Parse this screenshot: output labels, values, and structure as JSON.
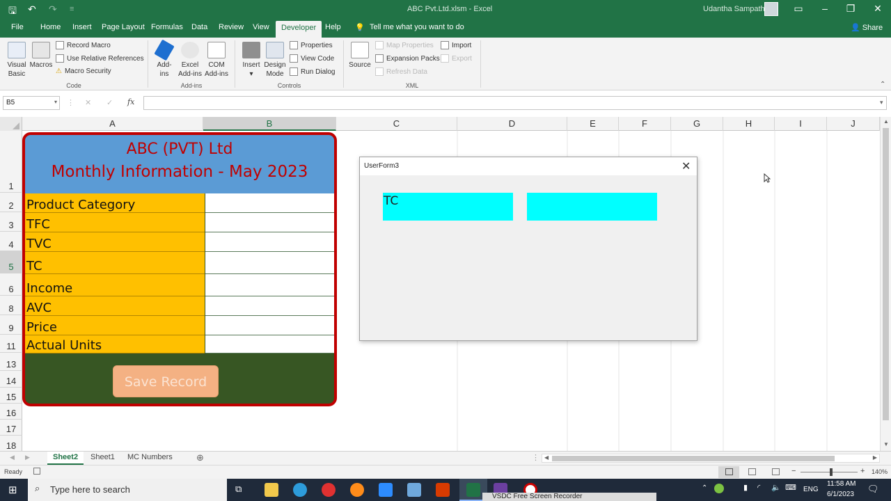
{
  "window": {
    "title": "ABC Pvt.Ltd.xlsm  -  Excel",
    "user": "Udantha Sampath",
    "share": "Share"
  },
  "tabs": [
    "File",
    "Home",
    "Insert",
    "Page Layout",
    "Formulas",
    "Data",
    "Review",
    "View",
    "Developer",
    "Help"
  ],
  "tell_me": "Tell me what you want to do",
  "ribbon": {
    "code": {
      "visual_basic": [
        "Visual",
        "Basic"
      ],
      "macros": "Macros",
      "record_macro": "Record Macro",
      "relative_refs": "Use Relative References",
      "macro_security": "Macro Security",
      "label": "Code"
    },
    "addins": {
      "addins": [
        "Add-",
        "ins"
      ],
      "excel_addins": [
        "Excel",
        "Add-ins"
      ],
      "com_addins": [
        "COM",
        "Add-ins"
      ],
      "label": "Add-ins"
    },
    "controls": {
      "insert": "Insert",
      "design_mode": [
        "Design",
        "Mode"
      ],
      "properties": "Properties",
      "view_code": "View Code",
      "run_dialog": "Run Dialog",
      "label": "Controls"
    },
    "xml": {
      "source": "Source",
      "map_properties": "Map Properties",
      "expansion_packs": "Expansion Packs",
      "refresh_data": "Refresh Data",
      "import": "Import",
      "export": "Export",
      "label": "XML"
    }
  },
  "formula_bar": {
    "name_box": "B5",
    "fx": "fx",
    "value": ""
  },
  "columns": [
    "A",
    "B",
    "C",
    "D",
    "E",
    "F",
    "G",
    "H",
    "I",
    "J"
  ],
  "rows": [
    "1",
    "2",
    "3",
    "4",
    "5",
    "6",
    "8",
    "9",
    "11",
    "13",
    "14",
    "15",
    "16",
    "17",
    "18"
  ],
  "sheet_form": {
    "title_line1": "ABC (PVT) Ltd",
    "title_line2": "Monthly Information - May 2023",
    "fields": [
      "Product Category",
      "TFC",
      "TVC",
      "TC",
      "Income",
      "AVC",
      "Price",
      "Actual Units"
    ],
    "button": "Save Record"
  },
  "userform": {
    "title": "UserForm3",
    "label": "TC",
    "textbox_value": ""
  },
  "sheet_tabs": [
    "Sheet2",
    "Sheet1",
    "MC Numbers"
  ],
  "status": {
    "ready": "Ready",
    "zoom": "140%"
  },
  "taskbar": {
    "search_placeholder": "Type here to search",
    "time": "11:58 AM",
    "date": "6/1/2023",
    "lang": "ENG",
    "recorder": "VSDC Free Screen Recorder"
  },
  "colors": {
    "excel_green": "#217346",
    "form_border": "#c00000",
    "label_fill": "#ffc000",
    "header_fill": "#5b9bd5",
    "userform_cyan": "#00ffff"
  }
}
